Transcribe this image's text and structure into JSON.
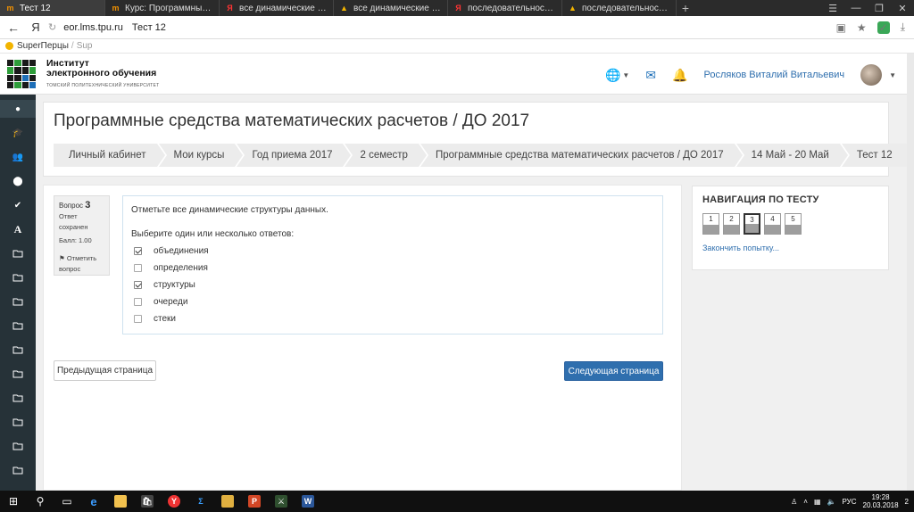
{
  "browser": {
    "tabs": [
      {
        "title": "Тест 12",
        "active": true,
        "icon": "moodle-icon"
      },
      {
        "title": "Курс: Программные средст",
        "active": false,
        "icon": "moodle-icon"
      },
      {
        "title": "все динамические структур",
        "active": false,
        "icon": "yandex-icon"
      },
      {
        "title": "все динамические структур",
        "active": false,
        "icon": "warning-icon"
      },
      {
        "title": "последовательность выпол",
        "active": false,
        "icon": "yandex-icon"
      },
      {
        "title": "последовательность выпол",
        "active": false,
        "icon": "warning-icon"
      }
    ],
    "new_tab": "+",
    "yandex_glyph": "Я",
    "address": {
      "domain": "eor.lms.tpu.ru",
      "page_title": "Тест 12"
    },
    "bookmarks": [
      {
        "label": "SuperПерцы"
      },
      {
        "label": "Sup"
      }
    ]
  },
  "site": {
    "org_line1": "Институт",
    "org_line2": "электронного обучения",
    "org_line3": "ТОМСКИЙ ПОЛИТЕХНИЧЕСКИЙ УНИВЕРСИТЕТ",
    "user_name": "Росляков Виталий Витальевич"
  },
  "page": {
    "title": "Программные средства математических расчетов / ДО 2017",
    "breadcrumb": [
      "Личный кабинет",
      "Мои курсы",
      "Год приема 2017",
      "2 семестр",
      "Программные средства математических расчетов / ДО 2017",
      "14 Май - 20 Май",
      "Тест 12"
    ]
  },
  "question": {
    "label": "Вопрос",
    "number": "3",
    "status_line1": "Ответ",
    "status_line2": "сохранен",
    "score": "Балл: 1.00",
    "flag_line1": "Отметить",
    "flag_line2": "вопрос",
    "text": "Отметьте все динамические структуры данных.",
    "prompt": "Выберите один или несколько ответов:",
    "answers": [
      {
        "label": "объединения",
        "checked": true
      },
      {
        "label": "определения",
        "checked": false
      },
      {
        "label": "структуры",
        "checked": true
      },
      {
        "label": "очереди",
        "checked": false
      },
      {
        "label": "стеки",
        "checked": false
      }
    ]
  },
  "buttons": {
    "prev": "Предыдущая страница",
    "next": "Следующая страница"
  },
  "test_nav": {
    "title": "НАВИГАЦИЯ ПО ТЕСТУ",
    "questions": [
      "1",
      "2",
      "3",
      "4",
      "5"
    ],
    "current": 3,
    "finish_link": "Закончить попытку..."
  },
  "taskbar": {
    "lang": "РУС",
    "time": "19:28",
    "date": "20.03.2018",
    "notifications": "2"
  },
  "colors": {
    "primary": "#2f6fae",
    "nav_dark": "#263238",
    "breadcrumb_bg": "#ececec"
  }
}
